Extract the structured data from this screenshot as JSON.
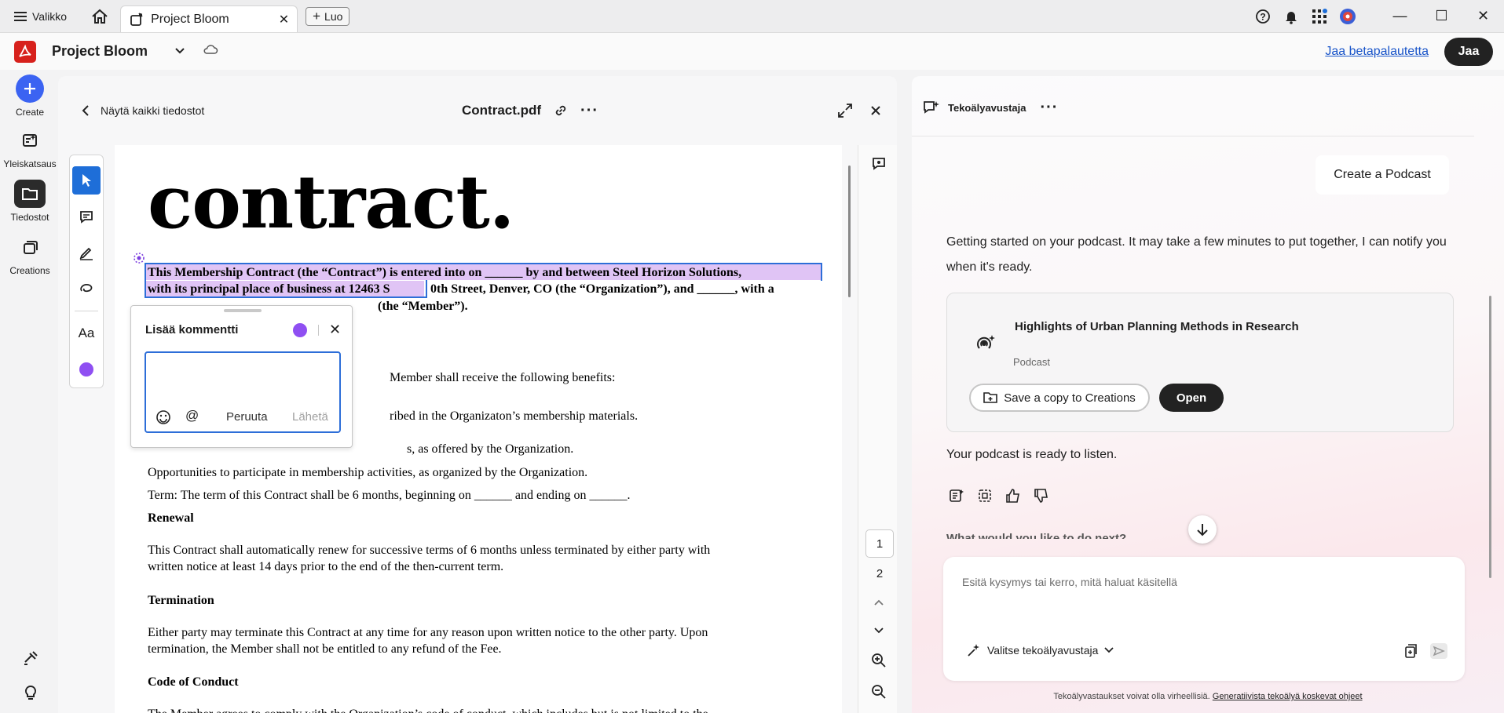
{
  "titlebar": {
    "menu_label": "Valikko",
    "tab_title": "Project Bloom",
    "new_tab_label": "Luo"
  },
  "appbar": {
    "project_title": "Project Bloom",
    "beta_link": "Jaa betapalautetta",
    "share_label": "Jaa",
    "brand_color": "#d7211c"
  },
  "rail": {
    "items": [
      {
        "label": "Create",
        "icon": "plus-icon"
      },
      {
        "label": "Yleiskatsaus",
        "icon": "overview-icon"
      },
      {
        "label": "Tiedostot",
        "icon": "folder-icon"
      },
      {
        "label": "Creations",
        "icon": "creations-icon"
      }
    ]
  },
  "doc": {
    "back_label": "Näytä kaikki tiedostot",
    "file_name": "Contract.pdf",
    "heading_word": "contract.",
    "lines": [
      "This Membership Contract (the “Contract”) is entered into on ______ by and between Steel Horizon Solutions,",
      "with its principal place of business at 12463 S",
      "0th Street, Denver, CO (the “Organization”), and ______, with a",
      "(the “Member”).",
      "Member shall receive the following benefits:",
      "ribed in the Organizaton’s membership materials.",
      "s, as offered by the Organization.",
      "Opportunities to participate in membership activities, as organized by the Organization.",
      "Term: The term of this Contract shall be 6 months, beginning on ______ and ending on ______.",
      "Renewal",
      "This Contract shall automatically renew for successive terms of 6 months unless terminated by either party with",
      "written notice at least 14 days prior to the end of the then-current term.",
      "Termination",
      "Either party may terminate this Contract at any time for any reason upon written notice to the other party. Upon",
      "termination, the Member shall not be entitled to any refund of the Fee.",
      "Code of Conduct",
      "The Member agrees to comply with the Organization’s code of conduct, which includes but is not limited to the"
    ],
    "pages": [
      "1",
      "2"
    ],
    "highlight_color": "#e0c4f5",
    "selection_color": "#2d6ed8"
  },
  "comment": {
    "title": "Lisää kommentti",
    "cancel_label": "Peruuta",
    "send_label": "Lähetä",
    "dot_color": "#8f4ff2"
  },
  "assistant": {
    "title": "Tekoälyavustaja",
    "user_prompt": "Create a Podcast",
    "response": "Getting started on your podcast. It may take a few minutes to put together, I can notify you when it's ready.",
    "podcast_title": "Highlights of Urban Planning Methods in Research",
    "podcast_type": "Podcast",
    "save_label": "Save a copy to Creations",
    "open_label": "Open",
    "ready_text": "Your podcast is ready to listen.",
    "clipped_text": "What would you like to do next?",
    "input_placeholder": "Esitä kysymys tai kerro, mitä haluat käsitellä",
    "select_label": "Valitse tekoälyavustaja",
    "disclaimer": "Tekoälyvastaukset voivat olla virheellisiä.",
    "disclaimer_link": "Generatiivista tekoälyä koskevat ohjeet"
  }
}
